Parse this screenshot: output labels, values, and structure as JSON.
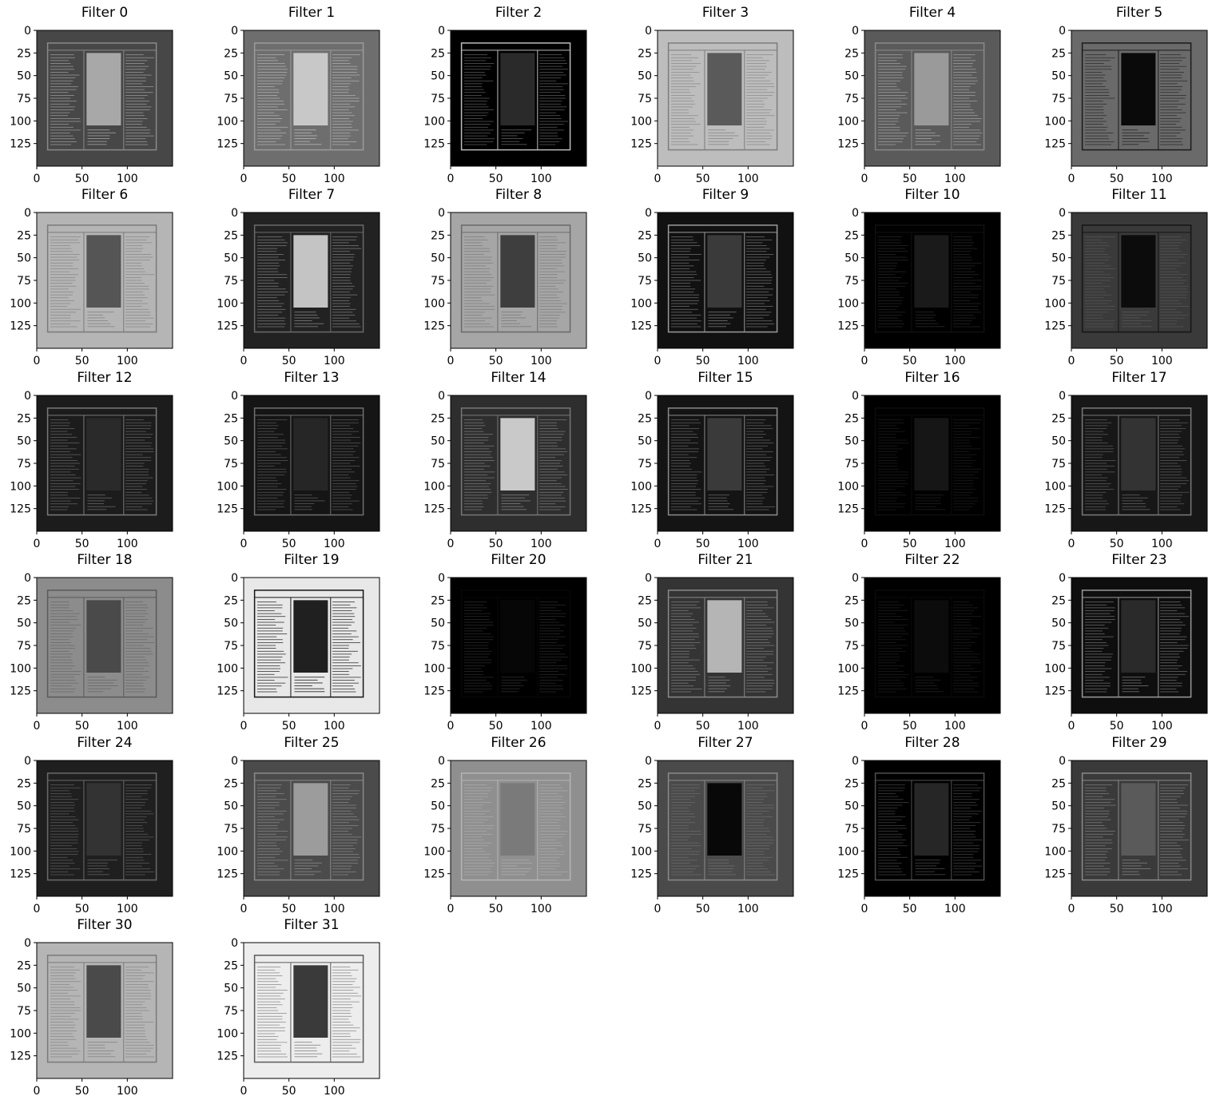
{
  "figure": {
    "axis": {
      "y_ticks": [
        "0",
        "25",
        "50",
        "75",
        "100",
        "125"
      ],
      "x_ticks": [
        "0",
        "50",
        "100"
      ],
      "image_extent": [
        150,
        150
      ]
    },
    "panels": [
      {
        "title": "Filter 0",
        "background": "#474747",
        "frame": "#8a8a8a",
        "center": "#a8a8a8",
        "text": "#9a9a9a"
      },
      {
        "title": "Filter 1",
        "background": "#6e6e6e",
        "frame": "#9c9c9c",
        "center": "#c8c8c8",
        "text": "#b0b0b0"
      },
      {
        "title": "Filter 2",
        "background": "#000000",
        "frame": "#bdbdbd",
        "center": "#2a2a2a",
        "text": "#5a5a5a"
      },
      {
        "title": "Filter 3",
        "background": "#bdbdbd",
        "frame": "#7d7d7d",
        "center": "#5a5a5a",
        "text": "#8c8c8c"
      },
      {
        "title": "Filter 4",
        "background": "#5a5a5a",
        "frame": "#8a8a8a",
        "center": "#9a9a9a",
        "text": "#a0a0a0"
      },
      {
        "title": "Filter 5",
        "background": "#6a6a6a",
        "frame": "#1a1a1a",
        "center": "#0a0a0a",
        "text": "#2a2a2a"
      },
      {
        "title": "Filter 6",
        "background": "#b5b5b5",
        "frame": "#7a7a7a",
        "center": "#555555",
        "text": "#888888"
      },
      {
        "title": "Filter 7",
        "background": "#222222",
        "frame": "#6a6a6a",
        "center": "#c4c4c4",
        "text": "#7a7a7a"
      },
      {
        "title": "Filter 8",
        "background": "#a6a6a6",
        "frame": "#6a6a6a",
        "center": "#3e3e3e",
        "text": "#7e7e7e"
      },
      {
        "title": "Filter 9",
        "background": "#111111",
        "frame": "#9a9a9a",
        "center": "#3a3a3a",
        "text": "#6e6e6e"
      },
      {
        "title": "Filter 10",
        "background": "#000000",
        "frame": "#111111",
        "center": "#1a1a1a",
        "text": "#262626"
      },
      {
        "title": "Filter 11",
        "background": "#3a3a3a",
        "frame": "#151515",
        "center": "#0c0c0c",
        "text": "#555555"
      },
      {
        "title": "Filter 12",
        "background": "#1c1c1c",
        "frame": "#7a7a7a",
        "center": "#2a2a2a",
        "text": "#606060"
      },
      {
        "title": "Filter 13",
        "background": "#151515",
        "frame": "#707070",
        "center": "#262626",
        "text": "#555555"
      },
      {
        "title": "Filter 14",
        "background": "#2e2e2e",
        "frame": "#777777",
        "center": "#c9c9c9",
        "text": "#777777"
      },
      {
        "title": "Filter 15",
        "background": "#141414",
        "frame": "#8a8a8a",
        "center": "#3a3a3a",
        "text": "#5e5e5e"
      },
      {
        "title": "Filter 16",
        "background": "#000000",
        "frame": "#0d0d0d",
        "center": "#161616",
        "text": "#1c1c1c"
      },
      {
        "title": "Filter 17",
        "background": "#171717",
        "frame": "#7a7a7a",
        "center": "#333333",
        "text": "#5a5a5a"
      },
      {
        "title": "Filter 18",
        "background": "#8c8c8c",
        "frame": "#5a5a5a",
        "center": "#4a4a4a",
        "text": "#6a6a6a"
      },
      {
        "title": "Filter 19",
        "background": "#e8e8e8",
        "frame": "#151515",
        "center": "#202020",
        "text": "#2a2a2a"
      },
      {
        "title": "Filter 20",
        "background": "#000000",
        "frame": "#080808",
        "center": "#060606",
        "text": "#2a2a2a"
      },
      {
        "title": "Filter 21",
        "background": "#343434",
        "frame": "#8a8a8a",
        "center": "#b5b5b5",
        "text": "#7a7a7a"
      },
      {
        "title": "Filter 22",
        "background": "#000000",
        "frame": "#0a0a0a",
        "center": "#0c0c0c",
        "text": "#1e1e1e"
      },
      {
        "title": "Filter 23",
        "background": "#0e0e0e",
        "frame": "#9a9a9a",
        "center": "#2a2a2a",
        "text": "#6a6a6a"
      },
      {
        "title": "Filter 24",
        "background": "#1f1f1f",
        "frame": "#6a6a6a",
        "center": "#333333",
        "text": "#5a5a5a"
      },
      {
        "title": "Filter 25",
        "background": "#4b4b4b",
        "frame": "#8a8a8a",
        "center": "#9c9c9c",
        "text": "#858585"
      },
      {
        "title": "Filter 26",
        "background": "#8f8f8f",
        "frame": "#b5b5b5",
        "center": "#7a7a7a",
        "text": "#aaaaaa"
      },
      {
        "title": "Filter 27",
        "background": "#4a4a4a",
        "frame": "#8a8a8a",
        "center": "#080808",
        "text": "#6a6a6a"
      },
      {
        "title": "Filter 28",
        "background": "#000000",
        "frame": "#505050",
        "center": "#262626",
        "text": "#404040"
      },
      {
        "title": "Filter 29",
        "background": "#3a3a3a",
        "frame": "#8a8a8a",
        "center": "#5a5a5a",
        "text": "#7a7a7a"
      },
      {
        "title": "Filter 30",
        "background": "#b5b5b5",
        "frame": "#7a7a7a",
        "center": "#4a4a4a",
        "text": "#888888"
      },
      {
        "title": "Filter 31",
        "background": "#ededed",
        "frame": "#5a5a5a",
        "center": "#3a3a3a",
        "text": "#8a8a8a"
      }
    ]
  }
}
